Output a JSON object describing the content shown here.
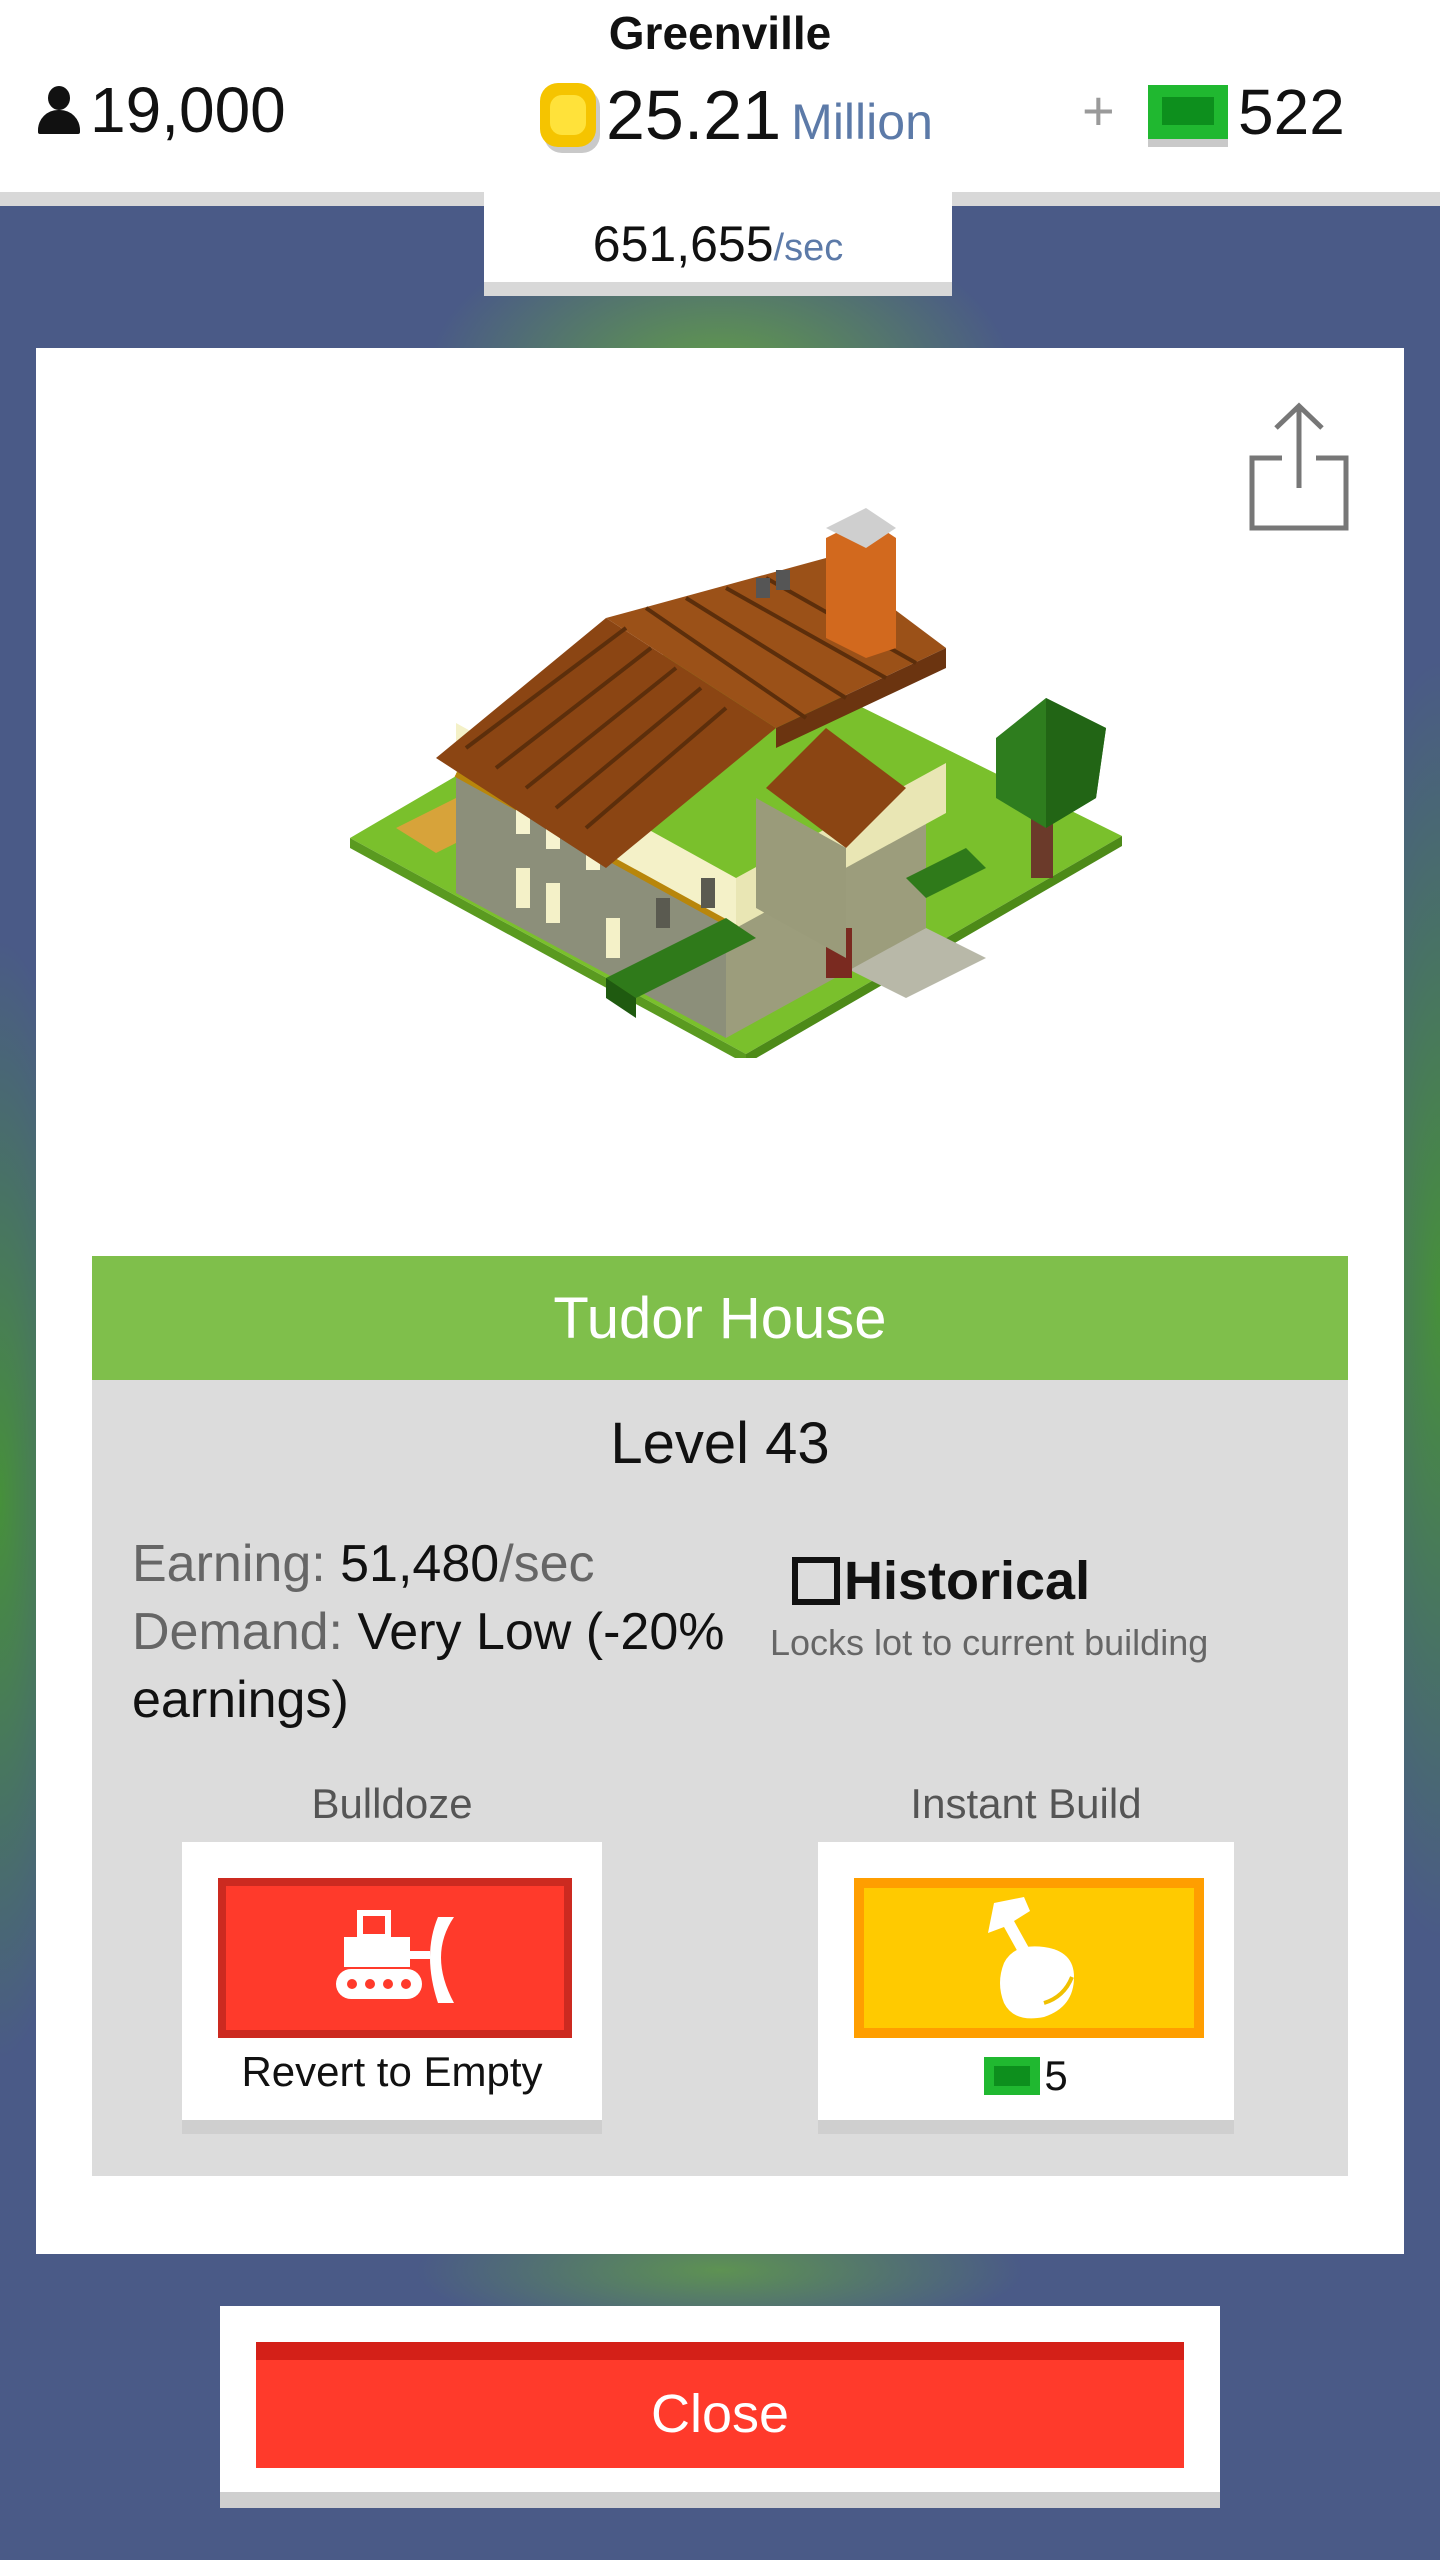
{
  "header": {
    "city_name": "Greenville",
    "population": "19,000",
    "money_value": "25.21",
    "money_unit": "Million",
    "plus": "+",
    "gems": "522",
    "rate_value": "651,655",
    "rate_unit": "/sec"
  },
  "building": {
    "name": "Tudor House",
    "level": "Level 43",
    "earning_label": "Earning:",
    "earning_value": "51,480",
    "earning_unit": "/sec",
    "demand_label": "Demand:",
    "demand_value": "Very Low (-20% earnings)",
    "historical_label": "Historical",
    "historical_desc": "Locks lot to current building",
    "historical_checked": false
  },
  "actions": {
    "bulldoze_label": "Bulldoze",
    "bulldoze_caption": "Revert to Empty",
    "instant_label": "Instant Build",
    "instant_cost": "5"
  },
  "close_label": "Close",
  "icons": {
    "population": "person-icon",
    "money": "coin-icon",
    "premium": "gem-icon",
    "share": "share-icon",
    "bulldoze": "bulldozer-icon",
    "instant": "hammer-hand-icon"
  },
  "colors": {
    "title_bar": "#7fbf4b",
    "bulldoze": "#ff3a2b",
    "instant": "#ffca00",
    "close": "#ff3a2b",
    "money_unit": "#5c7aa8",
    "background": "#4a5a87"
  }
}
